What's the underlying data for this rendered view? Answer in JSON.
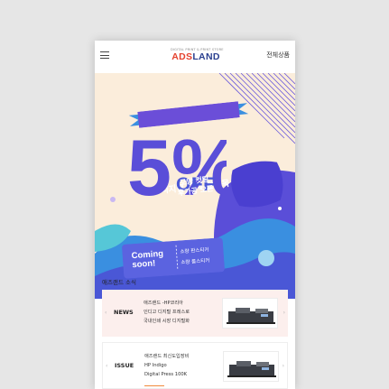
{
  "header": {
    "logo_sub": "DIGITAL PRINT & PRINT STORE",
    "logo_left": "ADS",
    "logo_right": "LAND",
    "all_products": "전체상품"
  },
  "banner": {
    "ribbon": "디지털 인쇄 전품목",
    "percent": "5%",
    "off": "OFF",
    "badge_line1": "모양 컷팅",
    "badge_line2": "후가공 오픈",
    "coming_line1": "Coming",
    "coming_line2": "soon!",
    "item1": "소량 판스티커",
    "item2": "소량 롤스티커",
    "colors": {
      "bg": "#fbeddb",
      "purple": "#4a57d6",
      "violet": "#6b4ed8",
      "blue": "#3a8fe0",
      "teal": "#56c7d7"
    }
  },
  "news": {
    "title": "애즈랜드 소식",
    "cards": [
      {
        "tag": "NEWS",
        "line1": "애즈랜드 -HP코리아",
        "line2": "인디고 디지털 프레스로",
        "line3": "국내인쇄 시장 디지털화"
      },
      {
        "tag": "ISSUE",
        "line1": "애즈랜드 최신도입장비",
        "line2": "HP Indigo",
        "line3": "Digital Press 100K"
      }
    ]
  }
}
